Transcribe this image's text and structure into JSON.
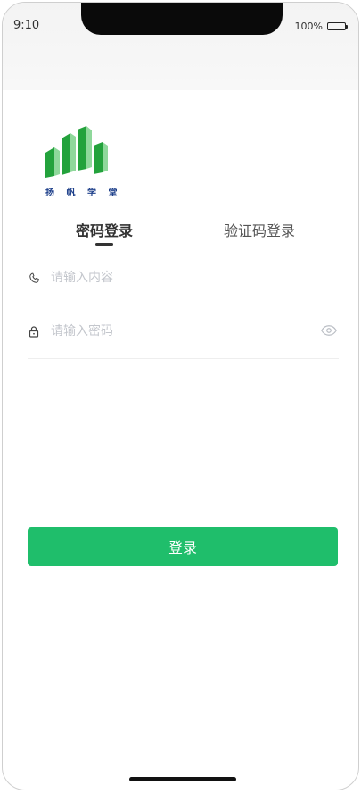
{
  "status_bar": {
    "time": "9:10",
    "battery": "100%"
  },
  "brand": {
    "logo_text": "扬 帆 学 堂",
    "logo_color": "#2fae46"
  },
  "tabs": [
    {
      "label": "密码登录",
      "active": true
    },
    {
      "label": "验证码登录",
      "active": false
    }
  ],
  "fields": {
    "phone": {
      "placeholder": "请输入内容",
      "value": "",
      "icon": "phone-icon"
    },
    "password": {
      "placeholder": "请输入密码",
      "value": "",
      "icon": "lock-icon",
      "toggle_icon": "eye-icon"
    }
  },
  "login_button": {
    "label": "登录",
    "color": "#1fbe6b"
  }
}
